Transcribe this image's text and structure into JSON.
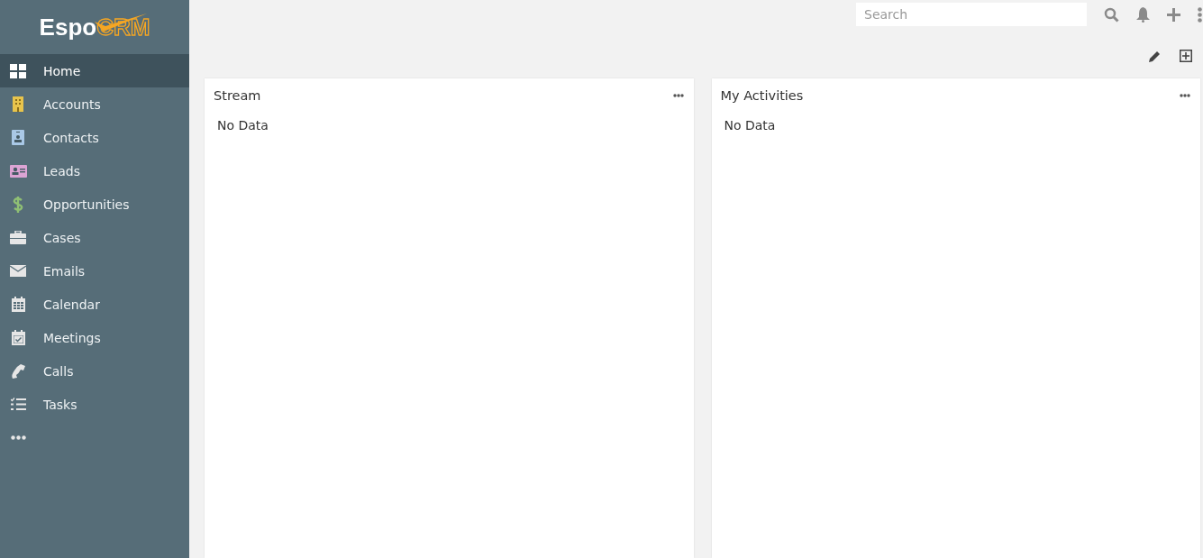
{
  "logo": {
    "part_1": "Espo",
    "part_2": "CRM"
  },
  "sidebar": {
    "items": [
      {
        "label": "Home",
        "selected": true
      },
      {
        "label": "Accounts",
        "selected": false
      },
      {
        "label": "Contacts",
        "selected": false
      },
      {
        "label": "Leads",
        "selected": false
      },
      {
        "label": "Opportunities",
        "selected": false
      },
      {
        "label": "Cases",
        "selected": false
      },
      {
        "label": "Emails",
        "selected": false
      },
      {
        "label": "Calendar",
        "selected": false
      },
      {
        "label": "Meetings",
        "selected": false
      },
      {
        "label": "Calls",
        "selected": false
      },
      {
        "label": "Tasks",
        "selected": false
      }
    ]
  },
  "search": {
    "placeholder": "Search"
  },
  "dashlets": [
    {
      "title": "Stream",
      "body": "No Data"
    },
    {
      "title": "My Activities",
      "body": "No Data"
    }
  ]
}
